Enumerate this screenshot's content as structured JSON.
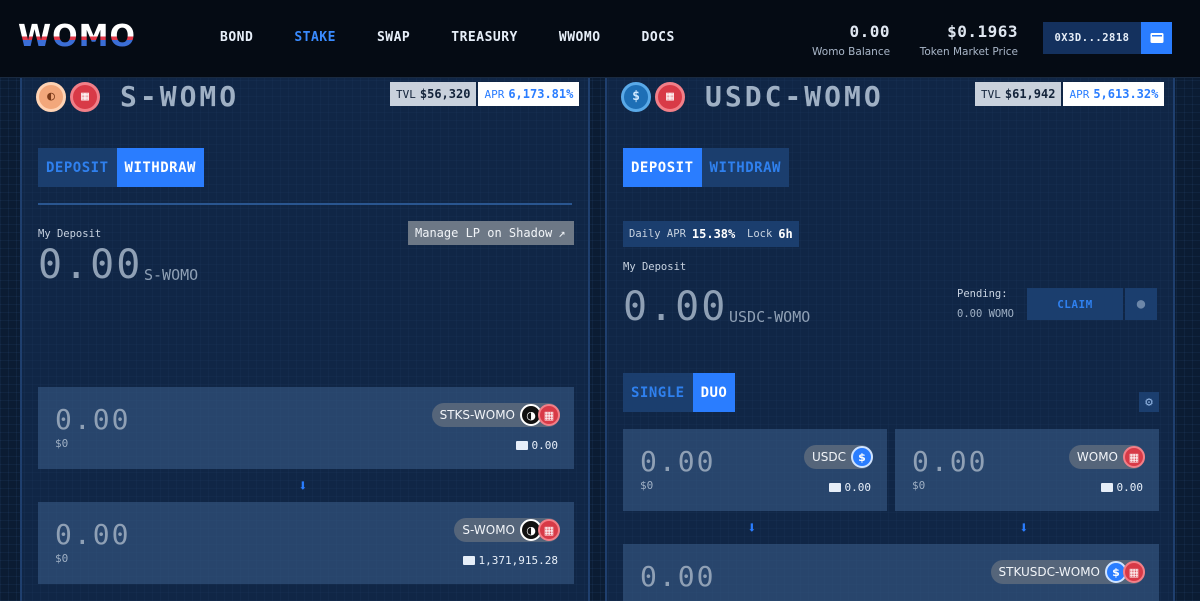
{
  "header": {
    "logo": "WOMO",
    "nav": [
      "BOND",
      "STAKE",
      "SWAP",
      "TREASURY",
      "WWOMO",
      "DOCS"
    ],
    "active_nav": "STAKE",
    "womo_balance": {
      "value": "0.00",
      "label": "Womo Balance"
    },
    "token_price": {
      "value": "$0.1963",
      "label": "Token Market Price"
    },
    "wallet_address": "0X3D...2818",
    "wallet_icon": "wallet-icon"
  },
  "left": {
    "title": "S-WOMO",
    "tvl_label": "TVL",
    "tvl": "$56,320",
    "apr_label": "APR",
    "apr": "6,173.81%",
    "tabs": {
      "deposit": "DEPOSIT",
      "withdraw": "WITHDRAW"
    },
    "active_tab": "WITHDRAW",
    "my_deposit_label": "My Deposit",
    "my_deposit": "0.00",
    "deposit_unit": "S-WOMO",
    "lp_button": "Manage LP on Shadow",
    "from": {
      "amount": "0.00",
      "usd": "$0",
      "token": "STKS-WOMO",
      "balance": "0.00"
    },
    "to": {
      "amount": "0.00",
      "usd": "$0",
      "token": "S-WOMO",
      "balance": "1,371,915.28"
    }
  },
  "right": {
    "title": "USDC-WOMO",
    "tvl_label": "TVL",
    "tvl": "$61,942",
    "apr_label": "APR",
    "apr": "5,613.32%",
    "tabs": {
      "deposit": "DEPOSIT",
      "withdraw": "WITHDRAW"
    },
    "active_tab": "DEPOSIT",
    "daily_apr_label": "Daily APR",
    "daily_apr": "15.38%",
    "lock_label": "Lock",
    "lock": "6h",
    "my_deposit_label": "My Deposit",
    "my_deposit": "0.00",
    "deposit_unit": "USDC-WOMO",
    "pending_label": "Pending:",
    "pending_value": "0.00 WOMO",
    "claim": "CLAIM",
    "mode_tabs": {
      "single": "SINGLE",
      "duo": "DUO"
    },
    "active_mode": "DUO",
    "in_a": {
      "amount": "0.00",
      "usd": "$0",
      "token": "USDC",
      "balance": "0.00"
    },
    "in_b": {
      "amount": "0.00",
      "usd": "$0",
      "token": "WOMO",
      "balance": "0.00"
    },
    "out": {
      "amount": "0.00",
      "token": "STKUSDC-WOMO"
    }
  }
}
